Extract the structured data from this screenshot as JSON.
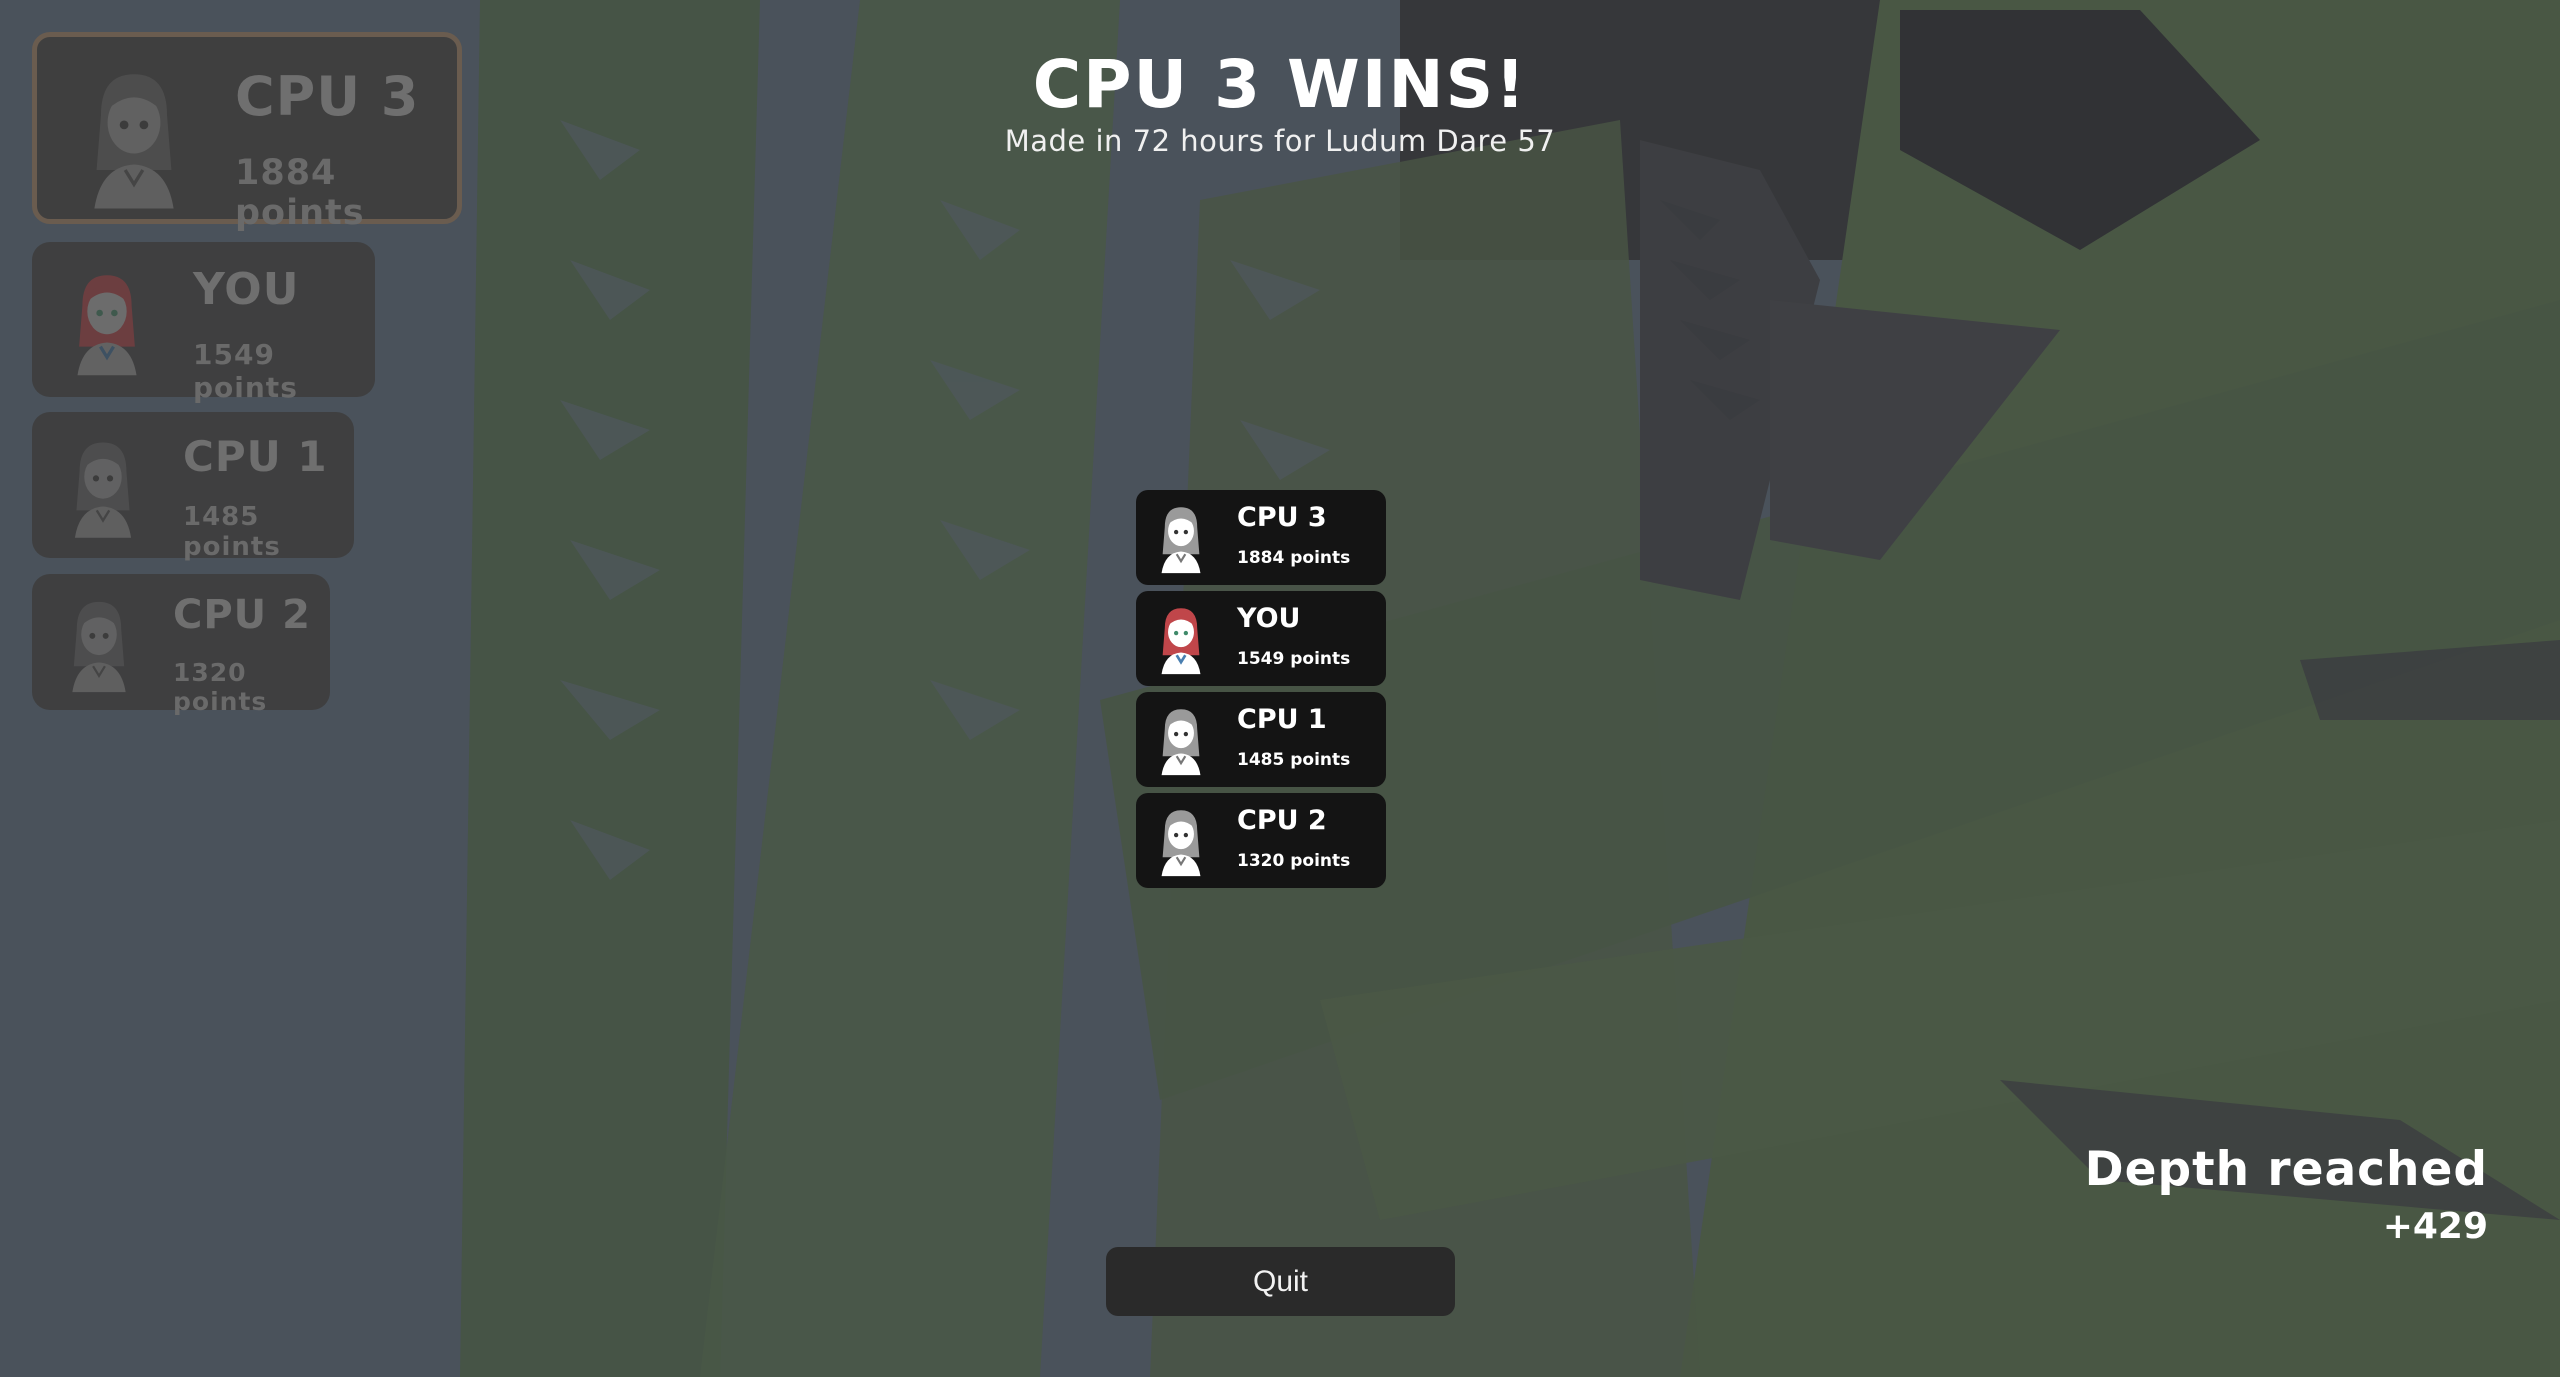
{
  "header": {
    "title": "CPU 3 WINS!",
    "subtitle": "Made in 72 hours for Ludum Dare 57"
  },
  "scoreboard": [
    {
      "name": "CPU 3",
      "points": "1884 points",
      "avatar": "gray-hair-girl-avatar"
    },
    {
      "name": "YOU",
      "points": "1549 points",
      "avatar": "red-hair-girl-avatar"
    },
    {
      "name": "CPU 1",
      "points": "1485 points",
      "avatar": "gray-hair-girl-avatar"
    },
    {
      "name": "CPU 2",
      "points": "1320 points",
      "avatar": "gray-hair-girl-avatar"
    }
  ],
  "results": [
    {
      "name": "CPU 3",
      "points": "1884 points",
      "avatar": "gray-hair-girl-avatar"
    },
    {
      "name": "YOU",
      "points": "1549 points",
      "avatar": "red-hair-girl-avatar"
    },
    {
      "name": "CPU 1",
      "points": "1485 points",
      "avatar": "gray-hair-girl-avatar"
    },
    {
      "name": "CPU 2",
      "points": "1320 points",
      "avatar": "gray-hair-girl-avatar"
    }
  ],
  "depth": {
    "label": "Depth reached",
    "value": "+429"
  },
  "quit_label": "Quit",
  "colors": {
    "background": "#4a525b",
    "foliage": "#4a5a40",
    "card": "#141414",
    "side_card": "#3e3e3e",
    "winner_border": "#6a5c4f",
    "player_hair": "#c0464a"
  }
}
